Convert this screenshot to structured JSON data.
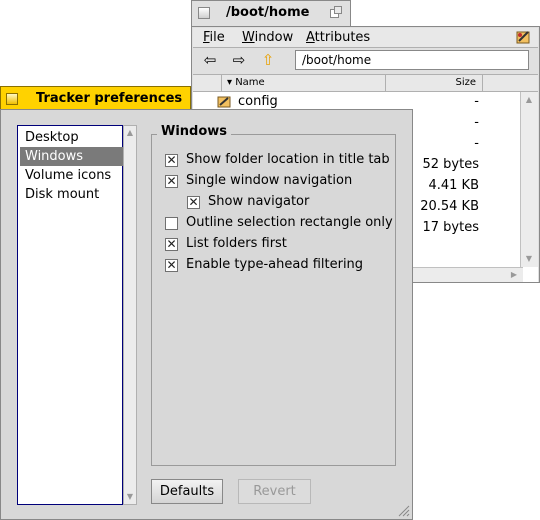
{
  "browser": {
    "title": "/boot/home",
    "menus": [
      "File",
      "Window",
      "Attributes"
    ],
    "menu_underline": [
      "F",
      "W",
      "A"
    ],
    "path": "/boot/home",
    "columns": {
      "name": "Name",
      "size": "Size"
    },
    "rows": [
      {
        "name": "config",
        "size": "-",
        "icon": "config-folder-icon"
      },
      {
        "name": "",
        "size": "-"
      },
      {
        "name": "",
        "size": "-"
      },
      {
        "name": "",
        "size": "52 bytes"
      },
      {
        "name": "",
        "size": "4.41 KB"
      },
      {
        "name": "",
        "size": "20.54 KB"
      },
      {
        "name": "",
        "size": "17 bytes"
      }
    ]
  },
  "prefs": {
    "title": "Tracker preferences",
    "categories": [
      "Desktop",
      "Windows",
      "Volume icons",
      "Disk mount"
    ],
    "selected_category": "Windows",
    "group_title": "Windows",
    "options": [
      {
        "label": "Show folder location in title tab",
        "checked": true
      },
      {
        "label": "Single window navigation",
        "checked": true
      },
      {
        "label": "Show navigator",
        "checked": true,
        "indent": true
      },
      {
        "label": "Outline selection rectangle only",
        "checked": false
      },
      {
        "label": "List folders first",
        "checked": true
      },
      {
        "label": "Enable type-ahead filtering",
        "checked": true
      }
    ],
    "buttons": {
      "defaults": "Defaults",
      "revert": "Revert"
    }
  },
  "colors": {
    "tab_active": "#ffd200",
    "tab_inactive": "#e0e0e0",
    "list_selection": "#7a7a7a",
    "list_border": "#00007a"
  }
}
